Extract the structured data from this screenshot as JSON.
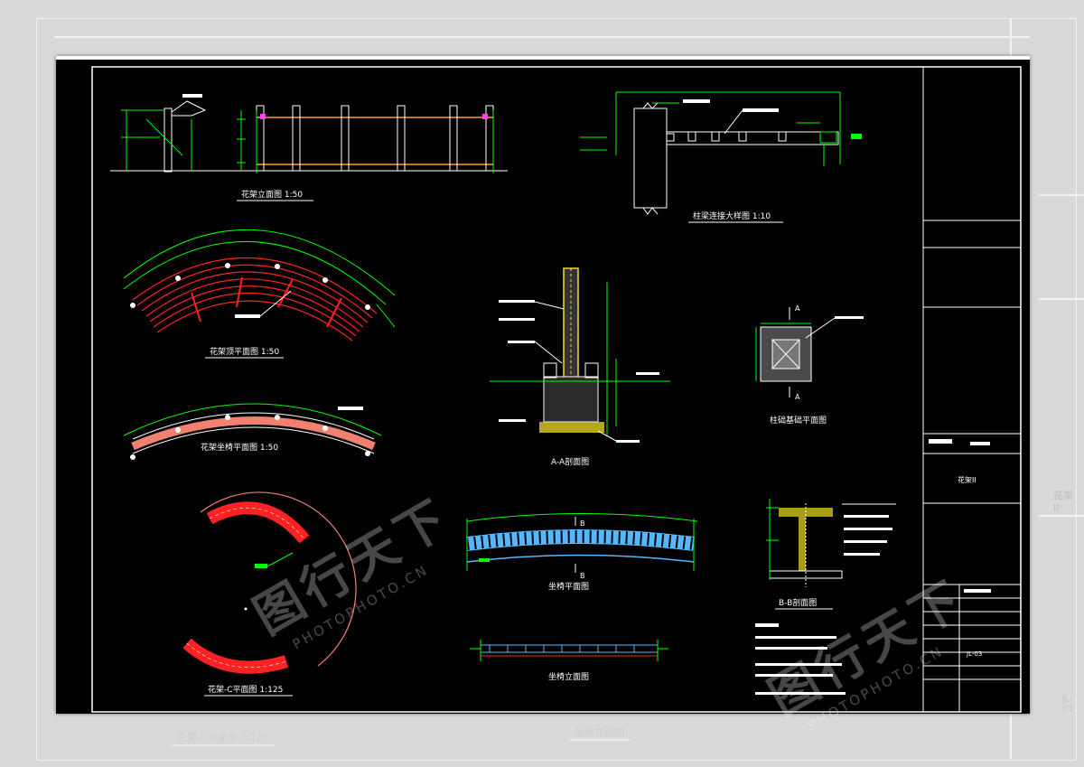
{
  "drawing": {
    "views": {
      "elevation": "花架立面图 1:50",
      "beam_detail": "柱梁连接大样图 1:10",
      "roof_plan": "花架顶平面图 1:50",
      "seat_plan": "花架坐椅平面图 1:50",
      "section_aa": "A-A剖面图",
      "base_plan": "柱础基础平面图",
      "plan_c": "花架-C平面图 1:125",
      "bench_plan": "坐椅平面图",
      "bench_elevation": "坐椅立面图",
      "section_bb": "B-B剖面图"
    },
    "section_marks": {
      "a": "A",
      "b": "B"
    },
    "title_block": {
      "project": "花架II",
      "sheet_no": "JL-03"
    }
  },
  "background": {
    "caption_left": "花架-C平面图 1:125",
    "caption_mid": "坐椅立面图",
    "caption_right": "花架II",
    "sheet_no": "JL-03"
  },
  "watermark": {
    "cn": "图行天下",
    "en": "PHOTOPHOTO.CN"
  },
  "colors": {
    "cad_background": "#000000",
    "frame": "#ffffff",
    "dimension": "#00ff00",
    "roof_red": "#ff2222",
    "seat_salmon": "#f08070",
    "bench_blue": "#55b8ff",
    "section_yellow": "#f0e020",
    "accent_magenta": "#ff40ff",
    "beam_orange": "#ff9a30"
  }
}
